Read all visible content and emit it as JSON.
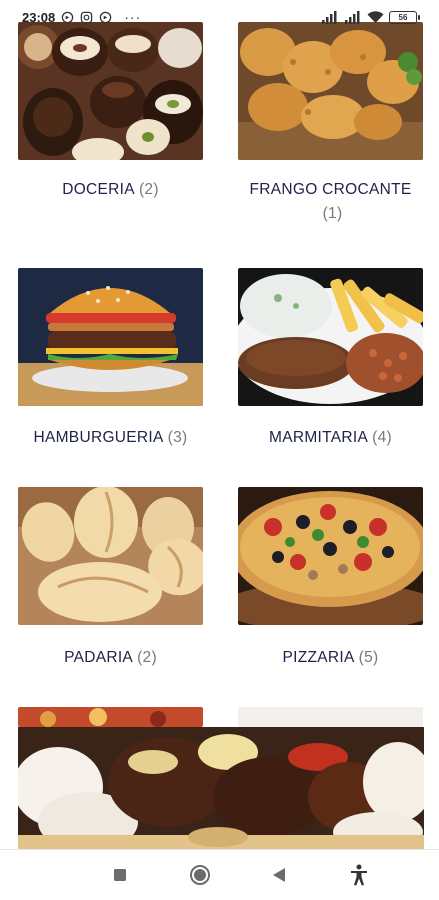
{
  "status_bar": {
    "time": "23:08",
    "dots": "···",
    "battery": "56"
  },
  "categories": [
    {
      "name": "DOCERIA",
      "count": "(2)"
    },
    {
      "name": "FRANGO CROCANTE",
      "count": "(1)"
    },
    {
      "name": "HAMBURGUERIA",
      "count": "(3)"
    },
    {
      "name": "MARMITARIA",
      "count": "(4)"
    },
    {
      "name": "PADARIA",
      "count": "(2)"
    },
    {
      "name": "PIZZARIA",
      "count": "(5)"
    }
  ],
  "icons": {
    "status_left": [
      "whatsapp-icon",
      "instagram-icon",
      "whatsapp-icon"
    ],
    "status_right": [
      "signal-icon",
      "signal-icon",
      "wifi-icon",
      "battery-icon"
    ],
    "nav": [
      "recent-apps-icon",
      "home-icon",
      "back-icon",
      "accessibility-icon"
    ]
  },
  "colors": {
    "label_text": "#20244a",
    "count_text": "#7a7a7a"
  }
}
